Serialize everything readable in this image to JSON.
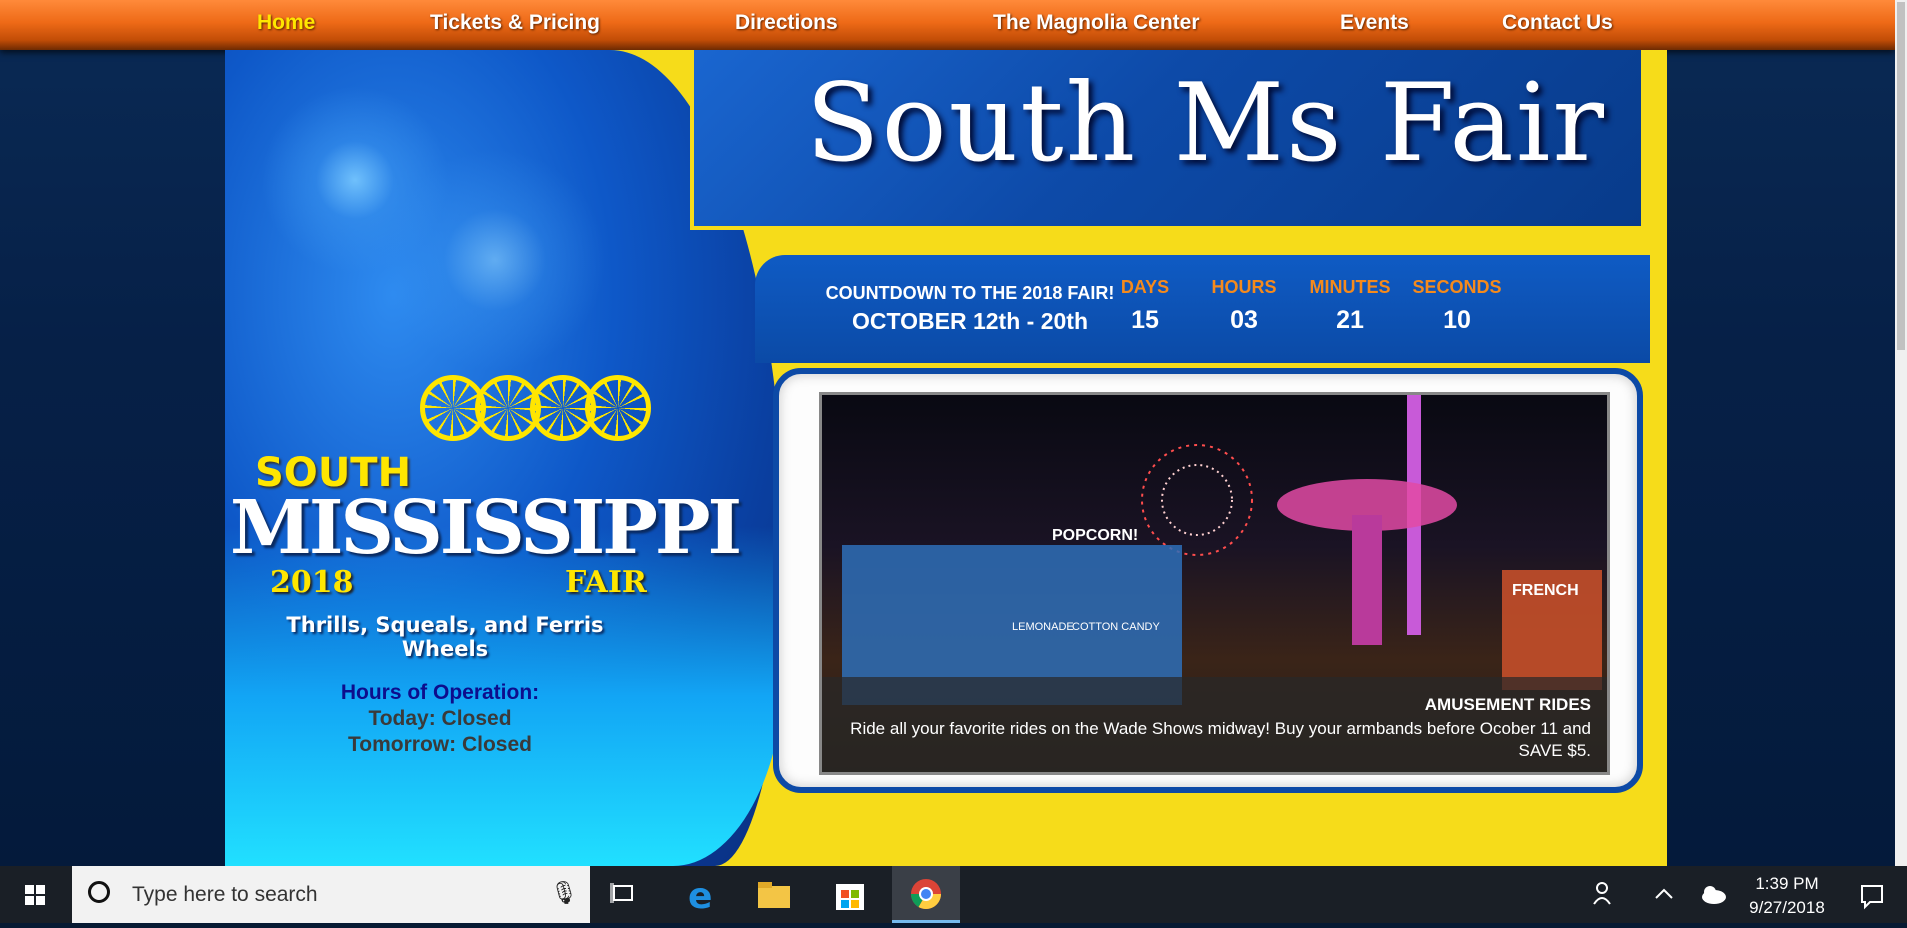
{
  "nav": {
    "items": [
      {
        "label": "Home",
        "active": true
      },
      {
        "label": "Tickets & Pricing"
      },
      {
        "label": "Directions"
      },
      {
        "label": "The Magnolia Center"
      },
      {
        "label": "Events"
      },
      {
        "label": "Contact Us"
      }
    ]
  },
  "header": {
    "title": "South Ms Fair"
  },
  "logo": {
    "south": "SOUTH",
    "mississippi": "MISSISSIPPI",
    "year": "2018",
    "fair": "FAIR",
    "tagline": "Thrills, Squeals, and Ferris Wheels"
  },
  "countdown": {
    "title": "COUNTDOWN TO THE 2018 FAIR!",
    "dates": "OCTOBER 12th - 20th",
    "units": [
      {
        "label": "DAYS",
        "value": "15"
      },
      {
        "label": "HOURS",
        "value": "03"
      },
      {
        "label": "MINUTES",
        "value": "21"
      },
      {
        "label": "SECONDS",
        "value": "10"
      }
    ]
  },
  "slide": {
    "title": "AMUSEMENT RIDES",
    "text": "Ride all your favorite rides on the Wade Shows midway! Buy your armbands before Ocober 11 and SAVE $5.",
    "signs": [
      "POPCORN!",
      "LEMONADE",
      "COTTON CANDY",
      "FRENCH"
    ]
  },
  "hours": {
    "title": "Hours of Operation:",
    "today": "Today:  Closed",
    "tomorrow": "Tomorrow: Closed"
  },
  "taskbar": {
    "search_placeholder": "Type here to search",
    "time": "1:39 PM",
    "date": "9/27/2018"
  },
  "colors": {
    "nav_orange": "#ee6a17",
    "active_yellow": "#ffe600",
    "site_yellow": "#f6dc1a",
    "site_blue": "#0d4aa6",
    "countdown_label": "#f58a1c"
  }
}
